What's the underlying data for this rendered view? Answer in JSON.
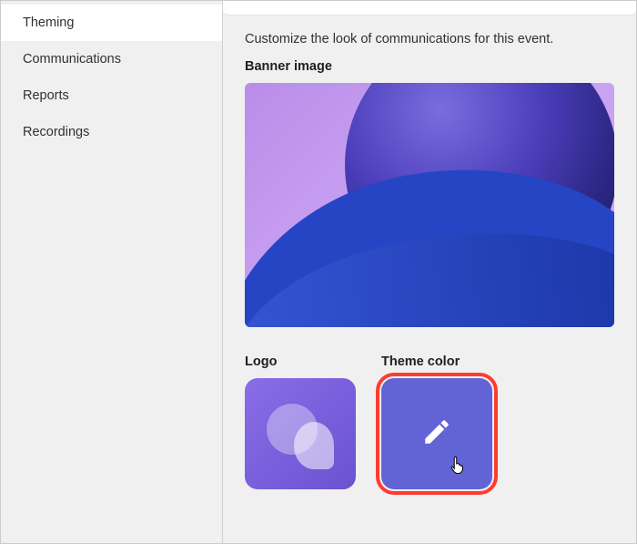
{
  "sidebar": {
    "items": [
      {
        "label": "Theming",
        "active": true
      },
      {
        "label": "Communications",
        "active": false
      },
      {
        "label": "Reports",
        "active": false
      },
      {
        "label": "Recordings",
        "active": false
      }
    ]
  },
  "main": {
    "description": "Customize the look of communications for this event.",
    "banner_label": "Banner image",
    "logo_label": "Logo",
    "theme_color_label": "Theme color"
  },
  "colors": {
    "theme_tile": "#6264d6",
    "highlight": "#ff3b30"
  }
}
